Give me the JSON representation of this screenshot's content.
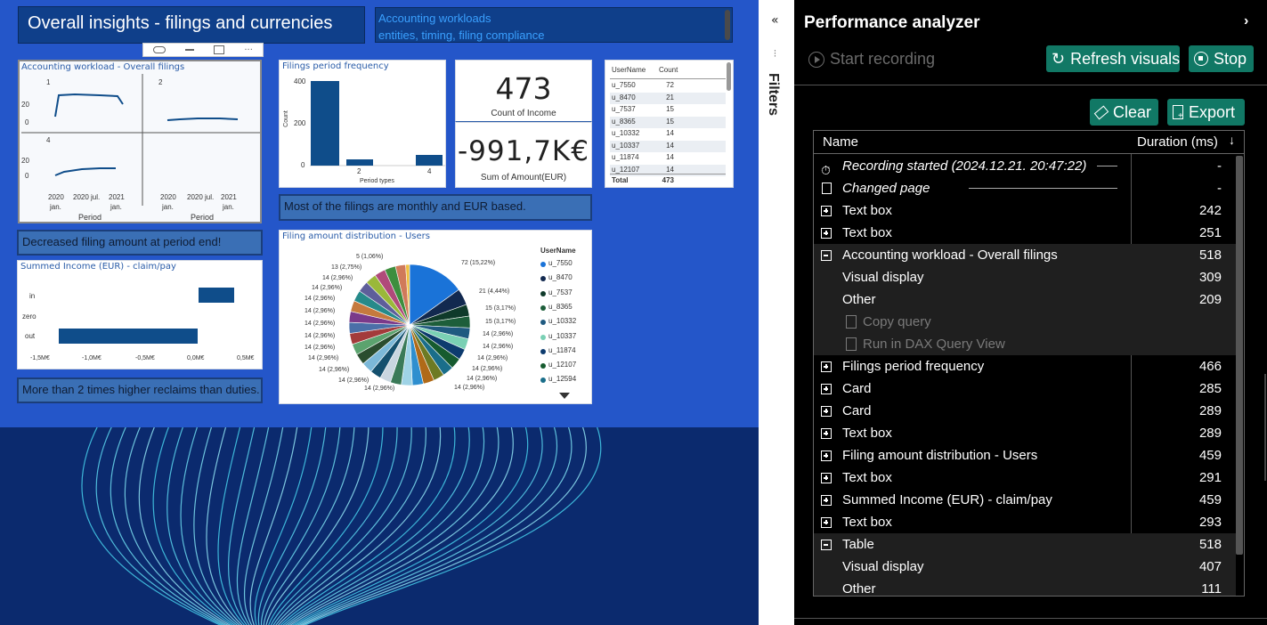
{
  "report": {
    "title": "Overall insights - filings and currencies",
    "subtitle_line1": "Accounting workloads",
    "subtitle_line2": "entities, timing, filing compliance",
    "workload": {
      "title": "Accounting workload - Overall filings",
      "panels": [
        "1",
        "2",
        "4"
      ],
      "yticks": [
        "20",
        "0"
      ],
      "xticks": [
        {
          "y": "2020",
          "m": "jan."
        },
        {
          "y": "2020 jul.",
          "m": ""
        },
        {
          "y": "2021",
          "m": "jan."
        }
      ],
      "xlabel": "Period"
    },
    "freq": {
      "title": "Filings period frequency",
      "ylabel": "Count",
      "xlabel": "Period types",
      "yticks": [
        "400",
        "200",
        "0"
      ],
      "xticks": [
        "2",
        "4"
      ]
    },
    "card1": {
      "value": "473",
      "label": "Count of Income"
    },
    "card2": {
      "value": "-991,7K€",
      "label": "Sum of Amount(EUR)"
    },
    "table": {
      "col1": "UserName",
      "col2": "Count",
      "rows": [
        {
          "name": "u_7550",
          "count": "72"
        },
        {
          "name": "u_8470",
          "count": "21"
        },
        {
          "name": "u_7537",
          "count": "15"
        },
        {
          "name": "u_8365",
          "count": "15"
        },
        {
          "name": "u_10332",
          "count": "14"
        },
        {
          "name": "u_10337",
          "count": "14"
        },
        {
          "name": "u_11874",
          "count": "14"
        },
        {
          "name": "u_12107",
          "count": "14"
        }
      ],
      "total_label": "Total",
      "total_value": "473"
    },
    "tb_monthly": "Most of the filings are monthly and EUR based.",
    "tb_decreased": "Decreased filing amount at period end!",
    "tb_reclaims": "More than 2 times higher reclaims than duties.",
    "income": {
      "title": "Summed Income (EUR) - claim/pay",
      "categories": [
        "in",
        "zero",
        "out"
      ],
      "xticks": [
        "-1,5M€",
        "-1,0M€",
        "-0,5M€",
        "0,0M€",
        "0,5M€"
      ]
    },
    "pie": {
      "title": "Filing amount distribution - Users",
      "legend_title": "UserName",
      "legend": [
        {
          "name": "u_7550",
          "color": "#1a73d8"
        },
        {
          "name": "u_8470",
          "color": "#12294f"
        },
        {
          "name": "u_7537",
          "color": "#0f3a2a"
        },
        {
          "name": "u_8365",
          "color": "#1d5e3a"
        },
        {
          "name": "u_10332",
          "color": "#1f5a80"
        },
        {
          "name": "u_10337",
          "color": "#7ad0b4"
        },
        {
          "name": "u_11874",
          "color": "#0d3b6e"
        },
        {
          "name": "u_12107",
          "color": "#165b2f"
        },
        {
          "name": "u_12594",
          "color": "#1a6e8a"
        }
      ],
      "labels_right": [
        "72 (15,22%)",
        "21 (4,44%)",
        "15 (3,17%)",
        "15 (3,17%)",
        "14 (2,96%)",
        "14 (2,96%)",
        "14 (2,96%)",
        "14 (2,96%)",
        "14 (2,96%)",
        "14 (2,96%)"
      ],
      "labels_left": [
        "5 (1,06%)",
        "13 (2,75%)",
        "14 (2,96%)",
        "14 (2,96%)",
        "14 (2,96%)",
        "14 (2,96%)",
        "14 (2,96%)",
        "14 (2,96%)",
        "14 (2,96%)",
        "14 (2,96%)",
        "14 (2,96%)",
        "14 (2,96%)"
      ],
      "label_bottom": "14 (2,96%)"
    }
  },
  "filters": {
    "label": "Filters"
  },
  "perf": {
    "title": "Performance analyzer",
    "start_recording": "Start recording",
    "refresh": "Refresh visuals",
    "stop": "Stop",
    "clear": "Clear",
    "export": "Export",
    "col_name": "Name",
    "col_duration": "Duration (ms)",
    "rows": [
      {
        "name": "Recording started (2024.12.21. 20:47:22)",
        "duration": "-",
        "kind": "clock"
      },
      {
        "name": "Changed page",
        "duration": "-",
        "kind": "page"
      },
      {
        "name": "Text box",
        "duration": "242",
        "kind": "plus"
      },
      {
        "name": "Text box",
        "duration": "251",
        "kind": "plus"
      },
      {
        "name": "Accounting workload - Overall filings",
        "duration": "518",
        "kind": "minus"
      },
      {
        "name": "Visual display",
        "duration": "309",
        "kind": "child"
      },
      {
        "name": "Other",
        "duration": "209",
        "kind": "child"
      },
      {
        "name": "Copy query",
        "duration": "",
        "kind": "action"
      },
      {
        "name": "Run in DAX Query View",
        "duration": "",
        "kind": "action"
      },
      {
        "name": "Filings period frequency",
        "duration": "466",
        "kind": "plus"
      },
      {
        "name": "Card",
        "duration": "285",
        "kind": "plus"
      },
      {
        "name": "Card",
        "duration": "289",
        "kind": "plus"
      },
      {
        "name": "Text box",
        "duration": "289",
        "kind": "plus"
      },
      {
        "name": "Filing amount distribution - Users",
        "duration": "459",
        "kind": "plus"
      },
      {
        "name": "Text box",
        "duration": "291",
        "kind": "plus"
      },
      {
        "name": "Summed Income (EUR) - claim/pay",
        "duration": "459",
        "kind": "plus"
      },
      {
        "name": "Text box",
        "duration": "293",
        "kind": "plus"
      },
      {
        "name": "Table",
        "duration": "518",
        "kind": "minus"
      },
      {
        "name": "Visual display",
        "duration": "407",
        "kind": "child"
      },
      {
        "name": "Other",
        "duration": "111",
        "kind": "child"
      }
    ]
  }
}
